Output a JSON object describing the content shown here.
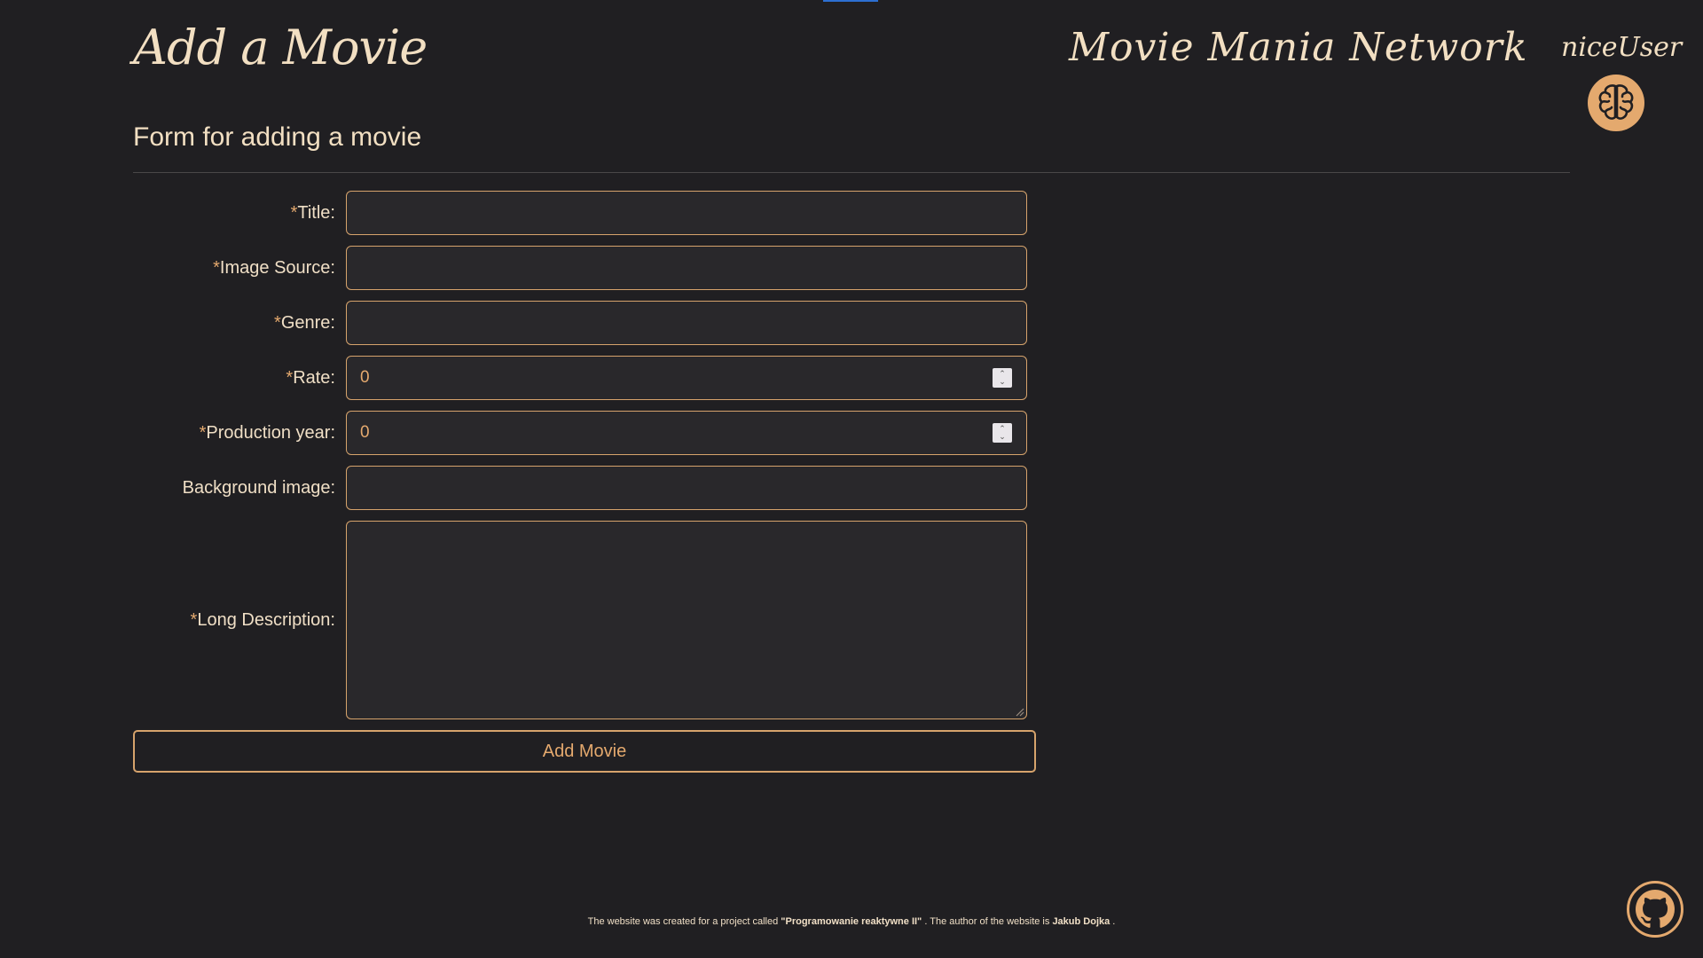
{
  "header": {
    "page_title": "Add a Movie",
    "brand": "Movie Mania Network",
    "username": "niceUser"
  },
  "form": {
    "heading": "Form for adding a movie",
    "required_mark": "*",
    "fields": {
      "title": {
        "label": "Title:",
        "value": ""
      },
      "image_source": {
        "label": "Image Source:",
        "value": ""
      },
      "genre": {
        "label": "Genre:",
        "value": ""
      },
      "rate": {
        "label": "Rate:",
        "value": "0"
      },
      "production_year": {
        "label": "Production year:",
        "value": "0"
      },
      "background_image": {
        "label": "Background image:",
        "value": ""
      },
      "long_description": {
        "label": "Long Description:",
        "value": ""
      }
    },
    "submit_label": "Add Movie"
  },
  "footer": {
    "text_1": "The website was created for a project called ",
    "project_name": "\"Programowanie reaktywne II\"",
    "text_2": " . The author of the website is ",
    "author": "Jakub Dojka",
    "text_3": " ."
  },
  "icons": {
    "avatar": "brain-icon",
    "github": "github-icon"
  },
  "colors": {
    "background": "#201f22",
    "accent": "#e4a96e",
    "text": "#f0dfc6",
    "input_bg": "#29282b"
  }
}
